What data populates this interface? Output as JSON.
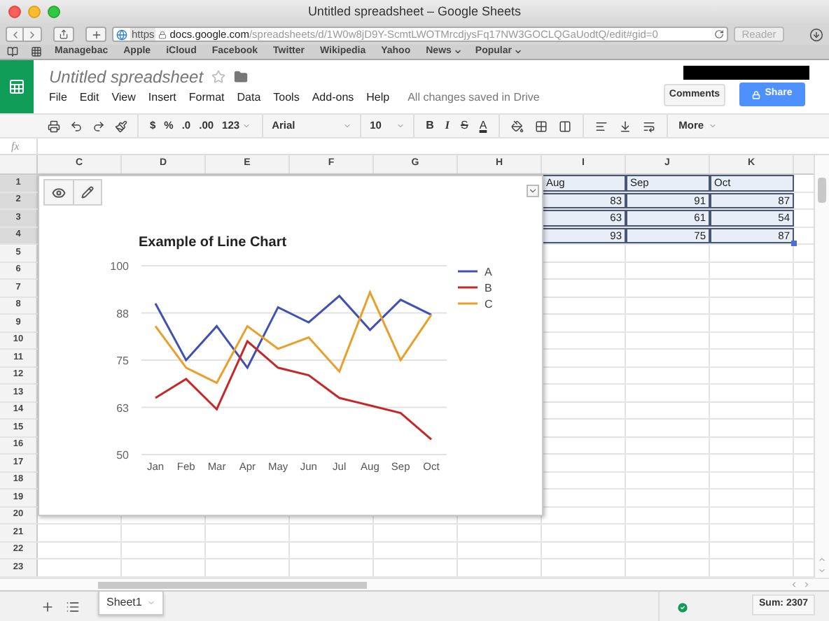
{
  "browser": {
    "title": "Untitled spreadsheet – Google Sheets",
    "url": {
      "scheme": "https",
      "host": "docs.google.com",
      "path": "/spreadsheets/d/1W0w8jD9Y-ScmtLWOTMrcdjysFq17NW3GOCLQGaUodtQ/edit#gid=0"
    },
    "reader": "Reader",
    "bookmarks": [
      {
        "label": "Managebac",
        "menu": false
      },
      {
        "label": "Apple",
        "menu": false
      },
      {
        "label": "iCloud",
        "menu": false
      },
      {
        "label": "Facebook",
        "menu": false
      },
      {
        "label": "Twitter",
        "menu": false
      },
      {
        "label": "Wikipedia",
        "menu": false
      },
      {
        "label": "Yahoo",
        "menu": false
      },
      {
        "label": "News",
        "menu": true
      },
      {
        "label": "Popular",
        "menu": true
      }
    ]
  },
  "doc": {
    "title": "Untitled spreadsheet",
    "starred": false,
    "menu": [
      "File",
      "Edit",
      "View",
      "Insert",
      "Format",
      "Data",
      "Tools",
      "Add-ons",
      "Help"
    ],
    "save_status": "All changes saved in Drive",
    "comments": "Comments",
    "share": "Share"
  },
  "toolbar": {
    "number_formats": [
      "$",
      "%",
      ".0",
      ".00",
      "123"
    ],
    "font": "Arial",
    "font_size": "10",
    "text_styles": [
      "B",
      "I",
      "S",
      "A"
    ],
    "more": "More"
  },
  "formula_bar": {
    "label": "fx"
  },
  "columns": [
    "C",
    "D",
    "E",
    "F",
    "G",
    "H",
    "I",
    "J",
    "K"
  ],
  "rows": [
    {
      "number": "1",
      "selected": true
    },
    {
      "number": "2",
      "selected": true
    },
    {
      "number": "3",
      "selected": true
    },
    {
      "number": "4",
      "selected": true
    },
    {
      "number": "5",
      "selected": false
    },
    {
      "number": "6",
      "selected": false
    },
    {
      "number": "7",
      "selected": false
    },
    {
      "number": "8",
      "selected": false
    },
    {
      "number": "9",
      "selected": false
    },
    {
      "number": "10",
      "selected": false
    },
    {
      "number": "11",
      "selected": false
    },
    {
      "number": "12",
      "selected": false
    },
    {
      "number": "13",
      "selected": false
    },
    {
      "number": "14",
      "selected": false
    },
    {
      "number": "15",
      "selected": false
    },
    {
      "number": "16",
      "selected": false
    },
    {
      "number": "17",
      "selected": false
    },
    {
      "number": "18",
      "selected": false
    },
    {
      "number": "19",
      "selected": false
    },
    {
      "number": "20",
      "selected": false
    },
    {
      "number": "21",
      "selected": false
    },
    {
      "number": "22",
      "selected": false
    },
    {
      "number": "23",
      "selected": false
    }
  ],
  "selection": {
    "header": [
      "Aug",
      "Sep",
      "Oct"
    ],
    "values": [
      [
        "83",
        "91",
        "87"
      ],
      [
        "63",
        "61",
        "54"
      ],
      [
        "93",
        "75",
        "87"
      ]
    ]
  },
  "chart": {
    "chart_data": {
      "type": "line",
      "title": "Example of Line Chart",
      "categories": [
        "Jan",
        "Feb",
        "Mar",
        "Apr",
        "May",
        "Jun",
        "Jul",
        "Aug",
        "Sep",
        "Oct"
      ],
      "grid": true,
      "legend": true,
      "ylim": [
        50,
        100
      ],
      "yticks": [
        {
          "value": 50,
          "label": "50"
        },
        {
          "value": 62.5,
          "label": "63"
        },
        {
          "value": 75,
          "label": "75"
        },
        {
          "value": 87.5,
          "label": "88"
        },
        {
          "value": 100,
          "label": "100"
        }
      ],
      "series": [
        {
          "name": "A",
          "color": "#3f51b5",
          "values": [
            90,
            75,
            84,
            73,
            89,
            85,
            92,
            83,
            91,
            87
          ]
        },
        {
          "name": "B",
          "color": "#c62828",
          "values": [
            65,
            70,
            62,
            80,
            73,
            71,
            65,
            63,
            61,
            54
          ]
        },
        {
          "name": "C",
          "color": "#e8a02a",
          "values": [
            84,
            73,
            69,
            84,
            78,
            81,
            72,
            93,
            75,
            87
          ]
        }
      ]
    }
  },
  "sheet_tabs": [
    {
      "label": "Sheet1",
      "selected": true
    }
  ],
  "sum": "Sum: 2307"
}
